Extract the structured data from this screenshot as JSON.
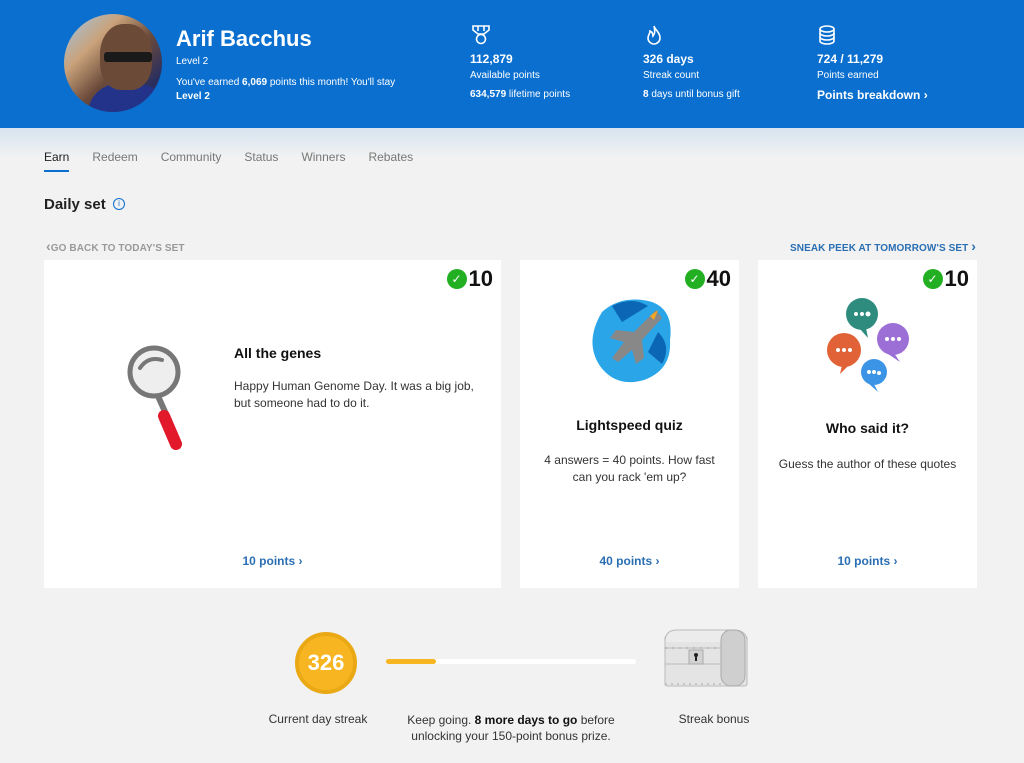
{
  "user": {
    "name": "Arif Bacchus",
    "level": "Level 2",
    "msg_prefix": "You've earned ",
    "msg_points": "6,069",
    "msg_middle": " points this month! You'll stay ",
    "msg_level": "Level 2"
  },
  "stats": [
    {
      "icon": "medal-icon",
      "value": "112,879",
      "label": "Available points",
      "sub_bold": "634,579",
      "sub_text": " lifetime points"
    },
    {
      "icon": "flame-icon",
      "value": "326 days",
      "label": "Streak count",
      "sub_bold": "8",
      "sub_text": " days until bonus gift"
    },
    {
      "icon": "coins-icon",
      "value": "724 / 11,279",
      "label": "Points earned",
      "link": "Points breakdown",
      "link_chevron": "›"
    }
  ],
  "tabs": [
    {
      "label": "Earn",
      "active": true
    },
    {
      "label": "Redeem"
    },
    {
      "label": "Community"
    },
    {
      "label": "Status"
    },
    {
      "label": "Winners"
    },
    {
      "label": "Rebates"
    }
  ],
  "daily_set": {
    "title": "Daily set",
    "info": "i",
    "back_label": "GO BACK TO TODAY'S SET",
    "next_label": "SNEAK PEEK AT TOMORROW'S SET",
    "cards": [
      {
        "badge": "10",
        "title": "All the genes",
        "desc": "Happy Human Genome Day. It was a big job, but someone had to do it.",
        "link": "10 points ›",
        "completed": true
      },
      {
        "badge": "40",
        "title": "Lightspeed quiz",
        "desc": "4 answers = 40 points. How fast can you rack 'em up?",
        "link": "40 points ›",
        "completed": true
      },
      {
        "badge": "10",
        "title": "Who said it?",
        "desc": "Guess the author of these quotes",
        "link": "10 points ›",
        "completed": true
      }
    ]
  },
  "streak": {
    "count": "326",
    "count_label": "Current day streak",
    "progress_fraction": 0.2,
    "msg_prefix": "Keep going. ",
    "msg_bold": "8 more days to go",
    "msg_suffix": " before unlocking your 150-point bonus prize.",
    "bonus_label": "Streak bonus"
  },
  "colors": {
    "brand": "#0a6fce",
    "check": "#22b022",
    "streak": "#f7b621",
    "link": "#2a6eb3"
  },
  "glyphs": {
    "check": "✓",
    "chev_left": "‹",
    "chev_right": "›"
  }
}
